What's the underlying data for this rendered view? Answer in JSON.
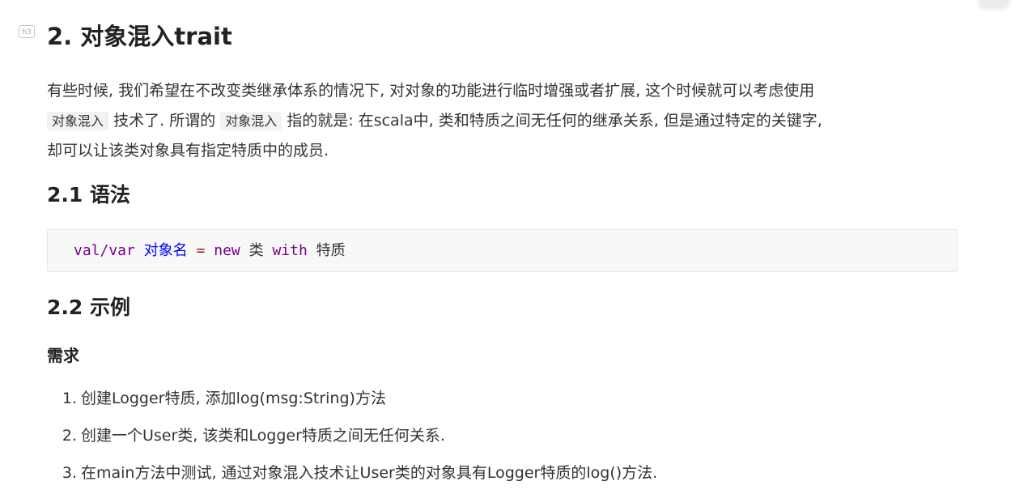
{
  "heading_marker": "h3",
  "title": "2. 对象混入trait",
  "intro": {
    "line1": "有些时候, 我们希望在不改变类继承体系的情况下, 对对象的功能进行临时增强或者扩展, 这个时候就可以考虑使用",
    "code1": "对象混入",
    "line2_mid": "技术了. 所谓的",
    "code2": "对象混入",
    "line2_end": "指的就是: 在scala中, 类和特质之间无任何的继承关系, 但是通过特定的关键字,",
    "line3": "却可以让该类对象具有指定特质中的成员."
  },
  "syntax_heading": "2.1 语法",
  "syntax_code": {
    "t1": "val/var",
    "t2": "对象名",
    "t3": "=",
    "t4": "new",
    "t5": "类",
    "t6": "with",
    "t7": "特质"
  },
  "example_heading": "2.2 示例",
  "requirement_heading": "需求",
  "requirements": [
    {
      "num": "1.",
      "text": "创建Logger特质, 添加log(msg:String)方法"
    },
    {
      "num": "2.",
      "text": "创建一个User类, 该类和Logger特质之间无任何关系."
    },
    {
      "num": "3.",
      "text": "在main方法中测试, 通过对象混入技术让User类的对象具有Logger特质的log()方法."
    }
  ]
}
